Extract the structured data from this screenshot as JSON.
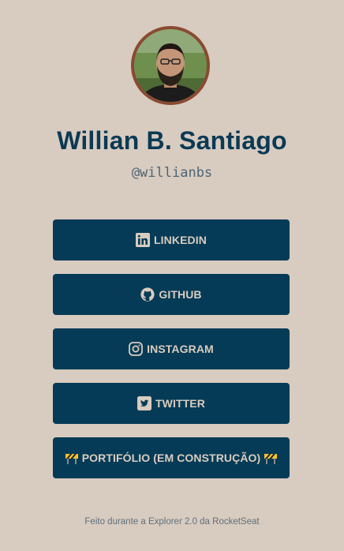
{
  "profile": {
    "name": "Willian B. Santiago",
    "handle": "@willianbs"
  },
  "links": [
    {
      "label": "LINKEDIN",
      "icon": "linkedin-icon"
    },
    {
      "label": "GITHUB",
      "icon": "github-icon"
    },
    {
      "label": "INSTAGRAM",
      "icon": "instagram-icon"
    },
    {
      "label": "TWITTER",
      "icon": "twitter-icon"
    },
    {
      "label": "PORTIFÓLIO (EM CONSTRUÇÃO)",
      "icon": "construction-icon"
    }
  ],
  "footer": {
    "text": "Feito durante a Explorer 2.0 da RocketSeat"
  },
  "colors": {
    "background": "#d8cbc0",
    "primary": "#053b56",
    "avatar_border": "#8a4a32",
    "button_text": "#d9ccc0"
  }
}
